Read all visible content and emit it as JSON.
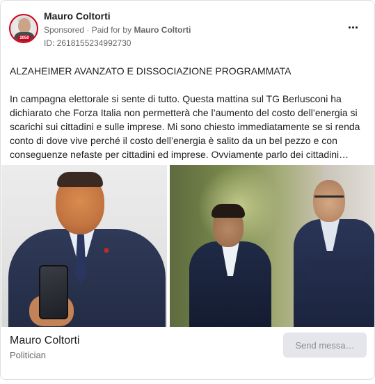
{
  "header": {
    "page_name": "Mauro Coltorti",
    "sponsored_label": "Sponsored",
    "paid_for_prefix": "Paid for by",
    "paid_for_name": "Mauro Coltorti",
    "ad_id": "ID: 2618155234992730",
    "avatar_badge": "2050"
  },
  "post": {
    "title": "ALZAHEIMER AVANZATO E DISSOCIAZIONE PROGRAMMATA",
    "body": "In campagna elettorale si sente di tutto. Questa mattina sul TG Berlusconi ha dichiarato che Forza Italia non permetterà che l’aumento del costo dell’energia si scarichi sui cittadini e sulle imprese. Mi sono chiesto immediatamente se si renda conto di dove vive perché il costo dell’energia è salito da un bel pezzo e con conseguenze nefaste per cittadini ed imprese. Ovviamente parlo dei cittadini…"
  },
  "footer": {
    "name": "Mauro Coltorti",
    "category": "Politician",
    "send_button": "Send messa…"
  }
}
